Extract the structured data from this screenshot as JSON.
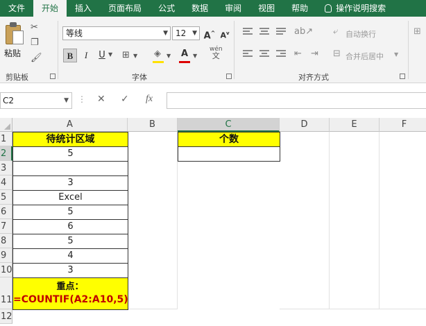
{
  "ribbon": {
    "tabs": [
      "文件",
      "开始",
      "插入",
      "页面布局",
      "公式",
      "数据",
      "审阅",
      "视图",
      "帮助"
    ],
    "search_label": "操作说明搜索",
    "clipboard": {
      "paste_label": "粘贴",
      "group_label": "剪贴板"
    },
    "font": {
      "font_name": "等线",
      "font_size": "12",
      "grow": "A",
      "shrink": "A",
      "bold": "B",
      "italic": "I",
      "underline": "U",
      "color_letter": "A",
      "wen": "wén",
      "wen2": "文",
      "group_label": "字体"
    },
    "alignment": {
      "wrap_label": "自动换行",
      "merge_label": "合并后居中",
      "group_label": "对齐方式"
    }
  },
  "formula_bar": {
    "name_box": "C2",
    "cancel": "✕",
    "confirm": "✓",
    "fx": "fx",
    "formula": ""
  },
  "grid": {
    "columns": [
      "A",
      "B",
      "C",
      "D",
      "E",
      "F"
    ],
    "rows": [
      "1",
      "2",
      "3",
      "4",
      "5",
      "6",
      "7",
      "8",
      "9",
      "10",
      "11",
      "12"
    ],
    "col_a": [
      "待统计区域",
      "5",
      "",
      "3",
      "Excel",
      "5",
      "6",
      "5",
      "4",
      "3"
    ],
    "c1": "个数",
    "c2": "",
    "note_title": "重点：",
    "note_formula": "=COUNTIF(A2:A10,5)"
  },
  "colors": {
    "accent": "#217346",
    "highlight": "#ffff00",
    "formula_text": "#c00000"
  }
}
